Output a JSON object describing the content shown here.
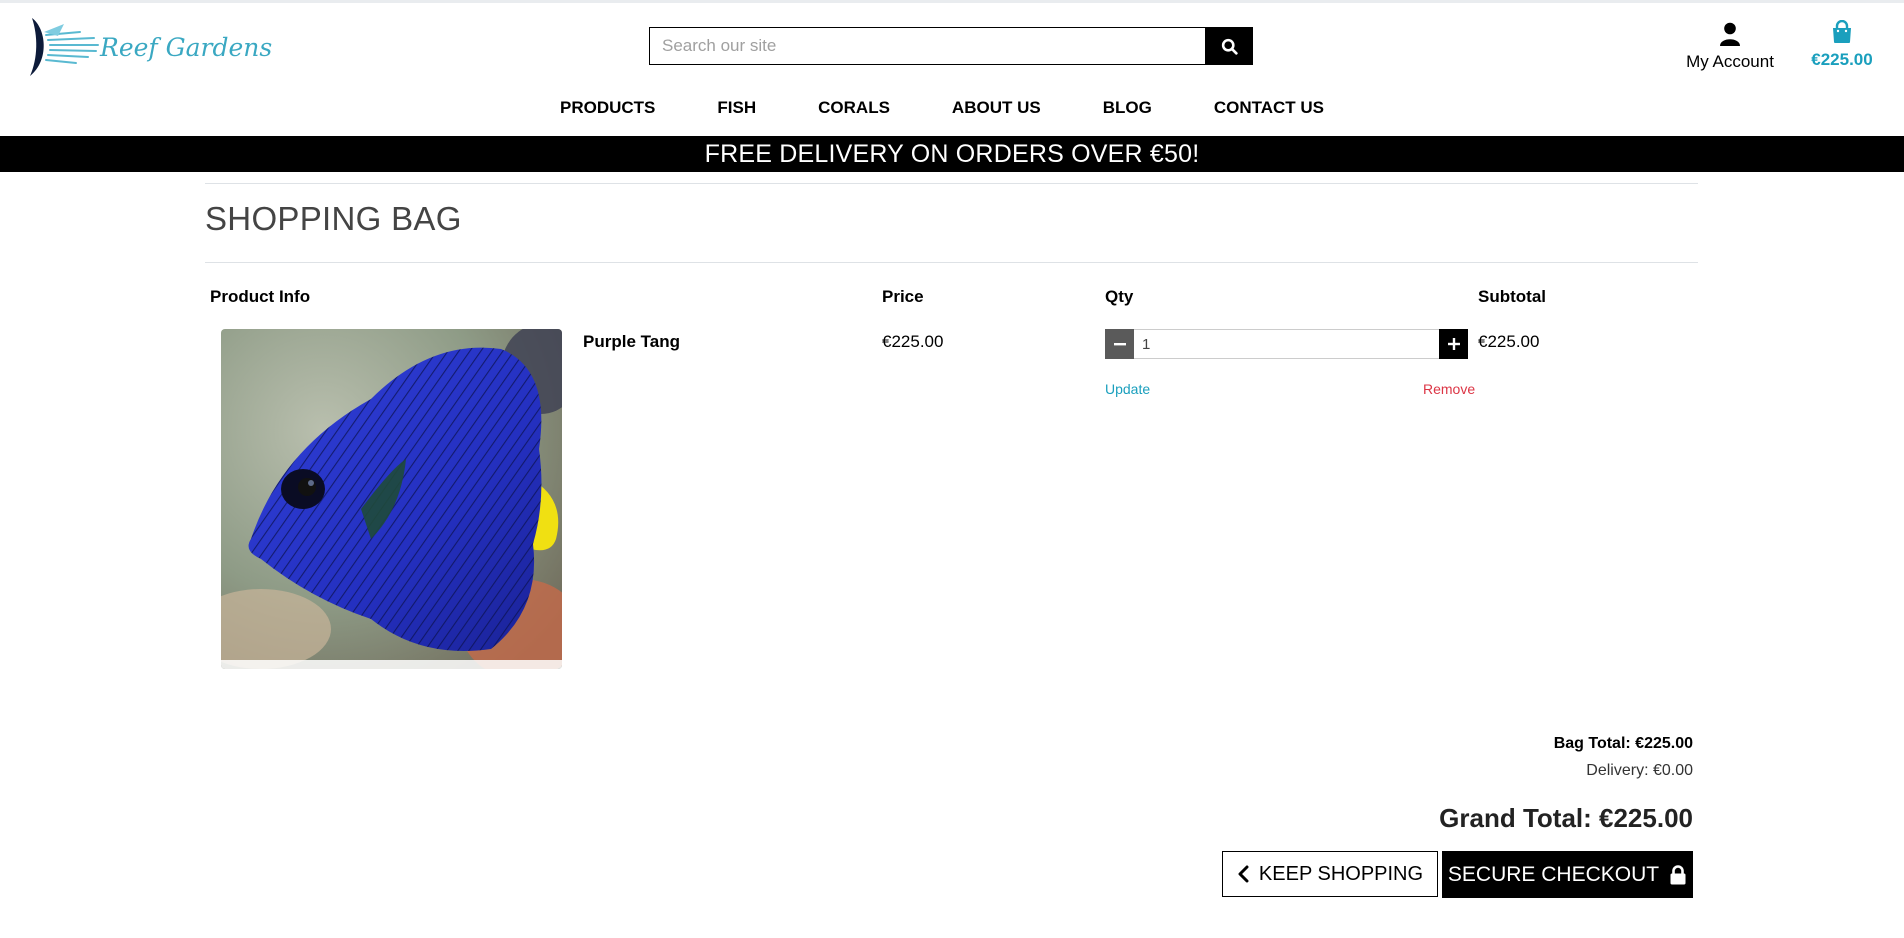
{
  "header": {
    "logo_text": "Reef Gardens",
    "search": {
      "placeholder": "Search our site",
      "value": "",
      "icon": "search-icon"
    },
    "account": {
      "label": "My Account",
      "icon": "user-icon"
    },
    "bag": {
      "total": "€225.00",
      "icon": "shopping-bag-icon"
    }
  },
  "nav": {
    "items": [
      "PRODUCTS",
      "FISH",
      "CORALS",
      "ABOUT US",
      "BLOG",
      "CONTACT US"
    ]
  },
  "banner": {
    "text": "FREE DELIVERY ON ORDERS OVER €50!"
  },
  "page": {
    "title": "SHOPPING BAG"
  },
  "table": {
    "headers": {
      "product": "Product Info",
      "price": "Price",
      "qty": "Qty",
      "subtotal": "Subtotal"
    },
    "rows": [
      {
        "name": "Purple Tang",
        "price": "€225.00",
        "qty": "1",
        "subtotal": "€225.00",
        "update_label": "Update",
        "remove_label": "Remove"
      }
    ]
  },
  "totals": {
    "bag_total": "Bag Total: €225.00",
    "delivery": "Delivery: €0.00",
    "grand_total": "Grand Total: €225.00"
  },
  "actions": {
    "keep_shopping": "KEEP SHOPPING",
    "secure_checkout": "SECURE CHECKOUT"
  },
  "colors": {
    "accent": "#1a9fbd",
    "remove": "#dc3545",
    "banner_bg": "#000000"
  }
}
